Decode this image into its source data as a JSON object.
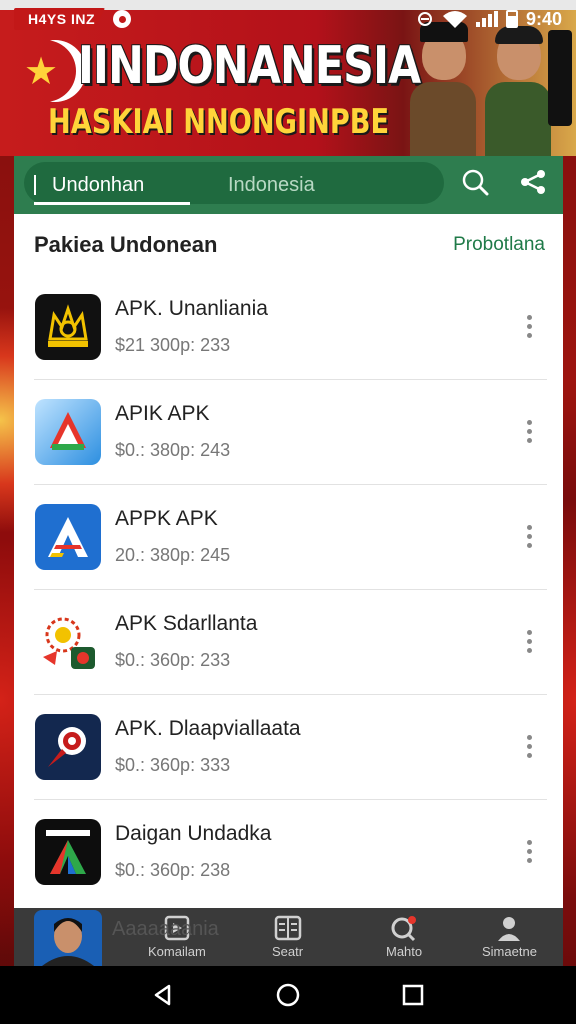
{
  "status_bar": {
    "left_tag": "H4YS INZ",
    "time": "9:40"
  },
  "banner": {
    "title": "IINDONANESIA",
    "subtitle": "HASKIAI NNONGINPBE"
  },
  "tabs": {
    "active": "Undonhan",
    "inactive": "Indonesia"
  },
  "section": {
    "title": "Pakiea Undonean",
    "link": "Probotlana"
  },
  "apps": [
    {
      "name": "APK. Unanliania",
      "meta": "$21 300p: 233",
      "icon": "crown-emblem-icon"
    },
    {
      "name": "APIK APK",
      "meta": "$0.: 380p: 243",
      "icon": "triangle-logo-icon"
    },
    {
      "name": "APPK APK",
      "meta": "20.: 380p: 245",
      "icon": "letter-a-logo-icon"
    },
    {
      "name": "APK Sdarllanta",
      "meta": "$0.: 360p: 233",
      "icon": "batik-emblem-icon"
    },
    {
      "name": "APK. Dlaapviallaata",
      "meta": "$0.: 360p: 333",
      "icon": "pin-marker-icon"
    },
    {
      "name": "Daigan Undadka",
      "meta": "$0.: 360p: 238",
      "icon": "gradient-a-logo-icon"
    }
  ],
  "faded_row": {
    "name": "Aaaaaaania"
  },
  "bottom_nav": [
    {
      "label": "Komailam",
      "icon": "media-icon"
    },
    {
      "label": "Seatr",
      "icon": "grid-icon"
    },
    {
      "label": "Mahto",
      "icon": "search-badge-icon"
    },
    {
      "label": "Simaetne",
      "icon": "person-icon"
    }
  ],
  "colors": {
    "primary_green": "#2e7d4f",
    "accent_link": "#1f7a48",
    "banner_red": "#c61c1c",
    "banner_gold": "#ffd43a"
  }
}
